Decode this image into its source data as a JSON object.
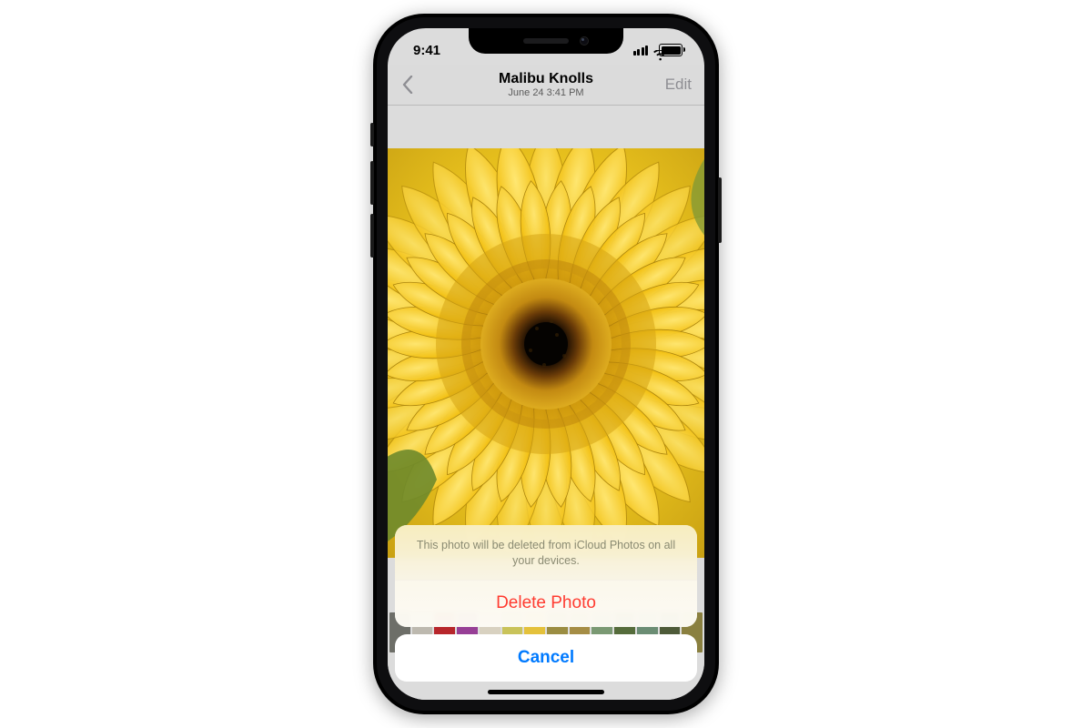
{
  "statusbar": {
    "time": "9:41"
  },
  "nav": {
    "title": "Malibu Knolls",
    "subtitle": "June 24  3:41 PM",
    "edit_label": "Edit"
  },
  "sheet": {
    "message": "This photo will be deleted from iCloud Photos on all your devices.",
    "delete_label": "Delete Photo",
    "cancel_label": "Cancel"
  },
  "thumbnails": {
    "colors": [
      "#6d6e68",
      "#bdb9af",
      "#b7262b",
      "#973f96",
      "#d8d1c0",
      "#c9c35a",
      "#e4c13b",
      "#9b8d42",
      "#a58d45",
      "#7a9973",
      "#556c3b",
      "#6b8d74",
      "#4e5b39",
      "#8a8040"
    ]
  }
}
